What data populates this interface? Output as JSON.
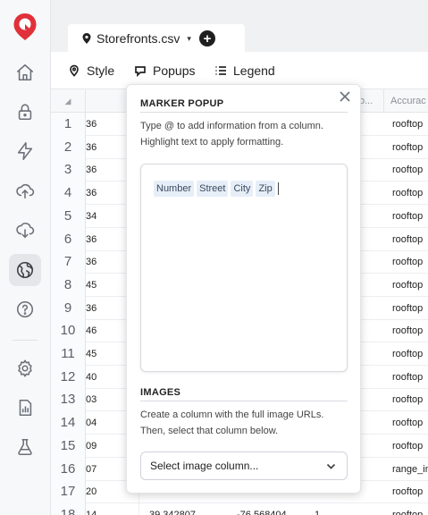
{
  "app": {
    "logo_icon": "map-pin-logo",
    "brand_color": "#e0303a"
  },
  "sidebar": {
    "items": [
      {
        "name": "home-icon"
      },
      {
        "name": "lock-icon"
      },
      {
        "name": "lightning-icon"
      },
      {
        "name": "upload-cloud-icon"
      },
      {
        "name": "download-cloud-icon"
      },
      {
        "name": "globe-icon",
        "active": true
      },
      {
        "name": "help-icon"
      },
      {
        "name": "settings-icon"
      },
      {
        "name": "report-icon"
      },
      {
        "name": "flask-icon"
      }
    ]
  },
  "tab": {
    "file_name": "Storefronts.csv",
    "caret": "▾",
    "add": "+"
  },
  "toolbar": {
    "style_label": "Style",
    "popups_label": "Popups",
    "legend_label": "Legend"
  },
  "grid": {
    "corner": "◢",
    "headers": [
      "o...",
      "Accurac"
    ],
    "rows": [
      {
        "num": "1",
        "c1": "36",
        "c5": "rooftop"
      },
      {
        "num": "2",
        "c1": "36",
        "c5": "rooftop"
      },
      {
        "num": "3",
        "c1": "36",
        "c5": "rooftop"
      },
      {
        "num": "4",
        "c1": "36",
        "c5": "rooftop"
      },
      {
        "num": "5",
        "c1": "34",
        "c5": "rooftop"
      },
      {
        "num": "6",
        "c1": "36",
        "c5": "rooftop"
      },
      {
        "num": "7",
        "c1": "36",
        "c5": "rooftop"
      },
      {
        "num": "8",
        "c1": "45",
        "c5": "rooftop"
      },
      {
        "num": "9",
        "c1": "36",
        "c5": "rooftop"
      },
      {
        "num": "10",
        "c1": "46",
        "c5": "rooftop"
      },
      {
        "num": "11",
        "c1": "45",
        "c5": "rooftop"
      },
      {
        "num": "12",
        "c1": "40",
        "c5": "rooftop"
      },
      {
        "num": "13",
        "c1": "03",
        "c5": "rooftop"
      },
      {
        "num": "14",
        "c1": "04",
        "c5": "rooftop"
      },
      {
        "num": "15",
        "c1": "09",
        "c5": "rooftop"
      },
      {
        "num": "16",
        "c1": "07",
        "c5": "range_in"
      },
      {
        "num": "17",
        "c1": "20",
        "c5": "rooftop"
      },
      {
        "num": "18",
        "c1": "14",
        "c5": "rooftop"
      }
    ],
    "partial_row_values": [
      "39.342807",
      "-76.568404",
      "1"
    ]
  },
  "popup": {
    "marker_title": "MARKER POPUP",
    "marker_help": "Type @ to add information from a column. Highlight text to apply formatting.",
    "chips": [
      "Number",
      "Street",
      "City",
      "Zip"
    ],
    "images_title": "IMAGES",
    "images_help": "Create a column with the full image URLs. Then, select that column below.",
    "select_placeholder": "Select image column..."
  }
}
